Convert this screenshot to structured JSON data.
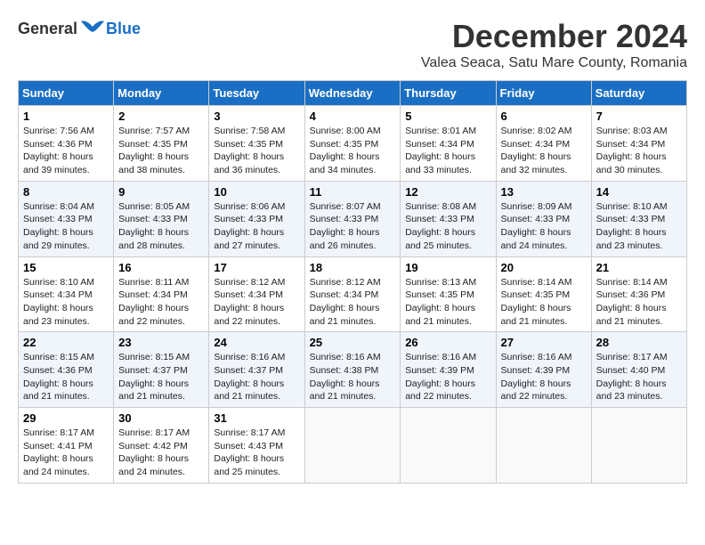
{
  "logo": {
    "general": "General",
    "blue": "Blue"
  },
  "title": "December 2024",
  "location": "Valea Seaca, Satu Mare County, Romania",
  "days_header": [
    "Sunday",
    "Monday",
    "Tuesday",
    "Wednesday",
    "Thursday",
    "Friday",
    "Saturday"
  ],
  "weeks": [
    [
      {
        "day": "1",
        "sunrise": "Sunrise: 7:56 AM",
        "sunset": "Sunset: 4:36 PM",
        "daylight": "Daylight: 8 hours and 39 minutes."
      },
      {
        "day": "2",
        "sunrise": "Sunrise: 7:57 AM",
        "sunset": "Sunset: 4:35 PM",
        "daylight": "Daylight: 8 hours and 38 minutes."
      },
      {
        "day": "3",
        "sunrise": "Sunrise: 7:58 AM",
        "sunset": "Sunset: 4:35 PM",
        "daylight": "Daylight: 8 hours and 36 minutes."
      },
      {
        "day": "4",
        "sunrise": "Sunrise: 8:00 AM",
        "sunset": "Sunset: 4:35 PM",
        "daylight": "Daylight: 8 hours and 34 minutes."
      },
      {
        "day": "5",
        "sunrise": "Sunrise: 8:01 AM",
        "sunset": "Sunset: 4:34 PM",
        "daylight": "Daylight: 8 hours and 33 minutes."
      },
      {
        "day": "6",
        "sunrise": "Sunrise: 8:02 AM",
        "sunset": "Sunset: 4:34 PM",
        "daylight": "Daylight: 8 hours and 32 minutes."
      },
      {
        "day": "7",
        "sunrise": "Sunrise: 8:03 AM",
        "sunset": "Sunset: 4:34 PM",
        "daylight": "Daylight: 8 hours and 30 minutes."
      }
    ],
    [
      {
        "day": "8",
        "sunrise": "Sunrise: 8:04 AM",
        "sunset": "Sunset: 4:33 PM",
        "daylight": "Daylight: 8 hours and 29 minutes."
      },
      {
        "day": "9",
        "sunrise": "Sunrise: 8:05 AM",
        "sunset": "Sunset: 4:33 PM",
        "daylight": "Daylight: 8 hours and 28 minutes."
      },
      {
        "day": "10",
        "sunrise": "Sunrise: 8:06 AM",
        "sunset": "Sunset: 4:33 PM",
        "daylight": "Daylight: 8 hours and 27 minutes."
      },
      {
        "day": "11",
        "sunrise": "Sunrise: 8:07 AM",
        "sunset": "Sunset: 4:33 PM",
        "daylight": "Daylight: 8 hours and 26 minutes."
      },
      {
        "day": "12",
        "sunrise": "Sunrise: 8:08 AM",
        "sunset": "Sunset: 4:33 PM",
        "daylight": "Daylight: 8 hours and 25 minutes."
      },
      {
        "day": "13",
        "sunrise": "Sunrise: 8:09 AM",
        "sunset": "Sunset: 4:33 PM",
        "daylight": "Daylight: 8 hours and 24 minutes."
      },
      {
        "day": "14",
        "sunrise": "Sunrise: 8:10 AM",
        "sunset": "Sunset: 4:33 PM",
        "daylight": "Daylight: 8 hours and 23 minutes."
      }
    ],
    [
      {
        "day": "15",
        "sunrise": "Sunrise: 8:10 AM",
        "sunset": "Sunset: 4:34 PM",
        "daylight": "Daylight: 8 hours and 23 minutes."
      },
      {
        "day": "16",
        "sunrise": "Sunrise: 8:11 AM",
        "sunset": "Sunset: 4:34 PM",
        "daylight": "Daylight: 8 hours and 22 minutes."
      },
      {
        "day": "17",
        "sunrise": "Sunrise: 8:12 AM",
        "sunset": "Sunset: 4:34 PM",
        "daylight": "Daylight: 8 hours and 22 minutes."
      },
      {
        "day": "18",
        "sunrise": "Sunrise: 8:12 AM",
        "sunset": "Sunset: 4:34 PM",
        "daylight": "Daylight: 8 hours and 21 minutes."
      },
      {
        "day": "19",
        "sunrise": "Sunrise: 8:13 AM",
        "sunset": "Sunset: 4:35 PM",
        "daylight": "Daylight: 8 hours and 21 minutes."
      },
      {
        "day": "20",
        "sunrise": "Sunrise: 8:14 AM",
        "sunset": "Sunset: 4:35 PM",
        "daylight": "Daylight: 8 hours and 21 minutes."
      },
      {
        "day": "21",
        "sunrise": "Sunrise: 8:14 AM",
        "sunset": "Sunset: 4:36 PM",
        "daylight": "Daylight: 8 hours and 21 minutes."
      }
    ],
    [
      {
        "day": "22",
        "sunrise": "Sunrise: 8:15 AM",
        "sunset": "Sunset: 4:36 PM",
        "daylight": "Daylight: 8 hours and 21 minutes."
      },
      {
        "day": "23",
        "sunrise": "Sunrise: 8:15 AM",
        "sunset": "Sunset: 4:37 PM",
        "daylight": "Daylight: 8 hours and 21 minutes."
      },
      {
        "day": "24",
        "sunrise": "Sunrise: 8:16 AM",
        "sunset": "Sunset: 4:37 PM",
        "daylight": "Daylight: 8 hours and 21 minutes."
      },
      {
        "day": "25",
        "sunrise": "Sunrise: 8:16 AM",
        "sunset": "Sunset: 4:38 PM",
        "daylight": "Daylight: 8 hours and 21 minutes."
      },
      {
        "day": "26",
        "sunrise": "Sunrise: 8:16 AM",
        "sunset": "Sunset: 4:39 PM",
        "daylight": "Daylight: 8 hours and 22 minutes."
      },
      {
        "day": "27",
        "sunrise": "Sunrise: 8:16 AM",
        "sunset": "Sunset: 4:39 PM",
        "daylight": "Daylight: 8 hours and 22 minutes."
      },
      {
        "day": "28",
        "sunrise": "Sunrise: 8:17 AM",
        "sunset": "Sunset: 4:40 PM",
        "daylight": "Daylight: 8 hours and 23 minutes."
      }
    ],
    [
      {
        "day": "29",
        "sunrise": "Sunrise: 8:17 AM",
        "sunset": "Sunset: 4:41 PM",
        "daylight": "Daylight: 8 hours and 24 minutes."
      },
      {
        "day": "30",
        "sunrise": "Sunrise: 8:17 AM",
        "sunset": "Sunset: 4:42 PM",
        "daylight": "Daylight: 8 hours and 24 minutes."
      },
      {
        "day": "31",
        "sunrise": "Sunrise: 8:17 AM",
        "sunset": "Sunset: 4:43 PM",
        "daylight": "Daylight: 8 hours and 25 minutes."
      },
      null,
      null,
      null,
      null
    ]
  ]
}
